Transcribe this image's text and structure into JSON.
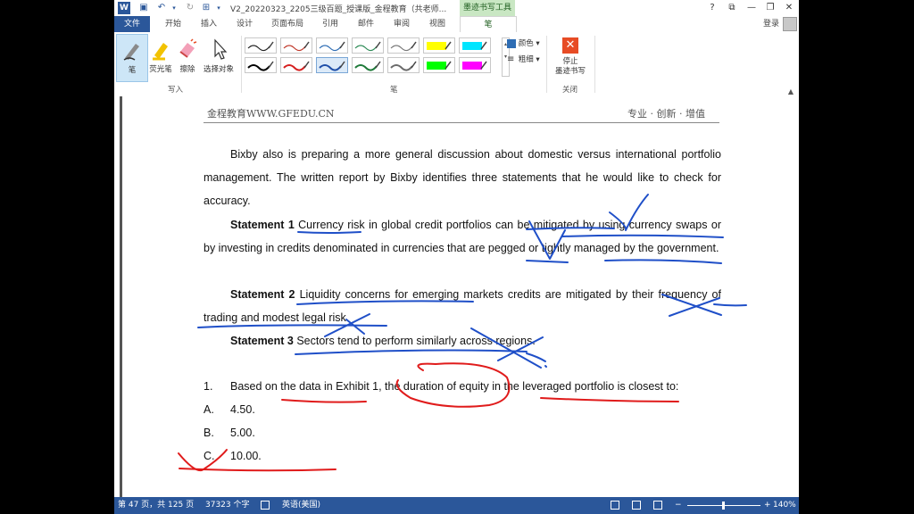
{
  "titlebar": {
    "doc_title": "V2_20220323_2205三级百题_授课版_金程教育（共老师...",
    "context_tab": "墨迹书写工具",
    "help": "?",
    "restore": "⧉",
    "minimize": "—",
    "maximize": "❐",
    "close": "✕"
  },
  "tabs": [
    "文件",
    "开始",
    "插入",
    "设计",
    "页面布局",
    "引用",
    "邮件",
    "审阅",
    "视图",
    "笔"
  ],
  "login": "登录",
  "ribbon": {
    "write_tools": [
      {
        "label": "笔",
        "icon": "pen-icon"
      },
      {
        "label": "荧光笔",
        "icon": "highlighter-icon"
      },
      {
        "label": "擦除",
        "icon": "eraser-icon"
      },
      {
        "label": "选择对象",
        "icon": "select-cursor-icon"
      }
    ],
    "write_group_label": "写入",
    "pen_group_label": "笔",
    "pen_colors_row1": [
      "#222222",
      "#c0392b",
      "#2e6db4",
      "#2e8b57",
      "#777777",
      "#ffff00",
      "#00e5ff"
    ],
    "pen_colors_row2": [
      "#000000",
      "#d62020",
      "#1f4fa8",
      "#1f7a3a",
      "#6b6b6b",
      "#00ff00",
      "#ff00ff"
    ],
    "color_label": "颜色",
    "weight_label": "粗细",
    "stop_label_1": "停止",
    "stop_label_2": "墨迹书写",
    "close_group_label": "关闭"
  },
  "document": {
    "header_left": "金程教育WWW.GFEDU.CN",
    "header_right": "专业 · 创新 · 增值",
    "intro": "Bixby also is preparing a more general discussion about domestic versus international portfolio management. The written report by Bixby identifies three statements that he would like to check for accuracy.",
    "s1_label": "Statement 1",
    "s1_text": "Currency risk in global credit portfolios can be mitigated by using currency swaps or by investing in credits denominated in currencies that are pegged or tightly managed by the government.",
    "s2_label": "Statement 2",
    "s2_text": "Liquidity concerns for emerging markets credits are mitigated by their frequency of trading and modest legal risk.",
    "s3_label": "Statement 3",
    "s3_text": "Sectors tend to perform similarly across regions.",
    "q_num": "1.",
    "q_text": "Based on the data in Exhibit 1, the duration of equity in the leveraged portfolio is closest to:",
    "options": [
      {
        "letter": "A.",
        "text": "4.50."
      },
      {
        "letter": "B.",
        "text": "5.00."
      },
      {
        "letter": "C.",
        "text": "10.00."
      }
    ],
    "ink_colors": {
      "blue": "#1f4fc8",
      "red": "#e01b1b"
    }
  },
  "status": {
    "page": "第 47 页，共 125 页",
    "words": "37323 个字",
    "language": "英语(美国)",
    "zoom": "140%"
  }
}
